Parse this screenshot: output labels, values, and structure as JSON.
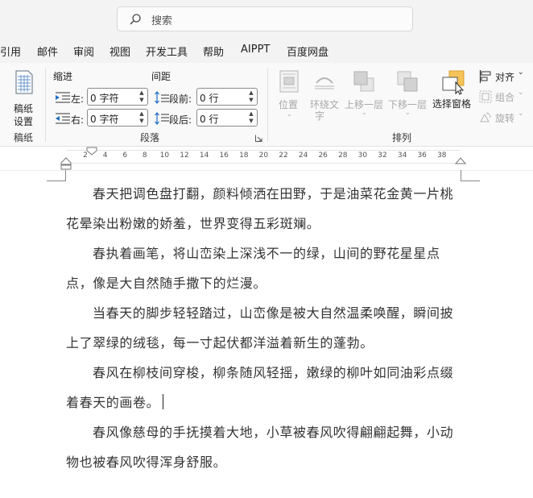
{
  "search": {
    "placeholder": "搜索"
  },
  "tabs": [
    "引用",
    "邮件",
    "审阅",
    "视图",
    "开发工具",
    "帮助",
    "AIPPT",
    "百度网盘"
  ],
  "ribbon": {
    "manuscript": {
      "button_label_line1": "稿纸",
      "button_label_line2": "设置",
      "group_label": "稿纸"
    },
    "paragraph": {
      "indent_header": "缩进",
      "spacing_header": "间距",
      "left_label": "左:",
      "right_label": "右:",
      "before_label": "段前:",
      "after_label": "段后:",
      "left_value": "0 字符",
      "right_value": "0 字符",
      "before_value": "0 行",
      "after_value": "0 行",
      "group_label": "段落"
    },
    "arrange": {
      "position_label": "位置",
      "wrap_label_line1": "环绕文",
      "wrap_label_line2": "字",
      "bring_forward_label": "上移一层",
      "send_backward_label": "下移一层",
      "selection_pane_label": "选择窗格",
      "align_label": "对齐",
      "group_label_btn": "组合",
      "rotate_label": "旋转",
      "group_label": "排列"
    }
  },
  "ruler": {
    "ticks": [
      "2",
      "4",
      "6",
      "8",
      "10",
      "12",
      "14",
      "16",
      "18",
      "20",
      "22",
      "24",
      "26",
      "28",
      "30",
      "32",
      "34",
      "36",
      "38"
    ]
  },
  "document": {
    "paragraphs": [
      "春天把调色盘打翻，颜料倾洒在田野，于是油菜花金黄一片桃花晕染出粉嫩的娇羞，世界变得五彩斑斓。",
      "春执着画笔，将山峦染上深浅不一的绿，山间的野花星星点点，像是大自然随手撒下的烂漫。",
      "当春天的脚步轻轻踏过，山峦像是被大自然温柔唤醒，瞬间披上了翠绿的绒毯，每一寸起伏都洋溢着新生的蓬勃。",
      "春风在柳枝间穿梭，柳条随风轻摇，嫩绿的柳叶如同油彩点缀着春天的画卷。",
      "春风像慈母的手抚摸着大地，小草被春风吹得翩翩起舞，小动物也被春风吹得浑身舒服。"
    ]
  },
  "colors": {
    "accent_selection_pane": "#f6c358",
    "ribbon_bg": "#f9f9f9",
    "titlebar_bg": "#f3f3f3"
  }
}
